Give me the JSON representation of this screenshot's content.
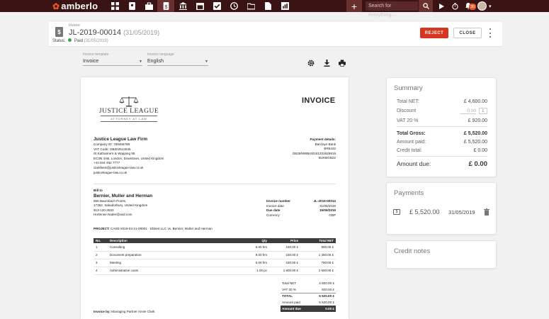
{
  "app": {
    "brand": "amberlo"
  },
  "topbar": {
    "search_placeholder": "Search for everything...",
    "notification_count": "30",
    "nav": [
      {
        "icon": "dashboard-icon"
      },
      {
        "icon": "contacts-icon"
      },
      {
        "icon": "matters-icon"
      },
      {
        "icon": "invoices-icon"
      },
      {
        "icon": "bank-icon"
      },
      {
        "icon": "calendar-icon"
      },
      {
        "icon": "tasks-icon"
      },
      {
        "icon": "time-icon"
      },
      {
        "icon": "folder-icon"
      },
      {
        "icon": "documents-icon"
      },
      {
        "icon": "reports-icon"
      }
    ]
  },
  "header": {
    "doc_type": "Invoice",
    "doc_number": "JL-2019-00014",
    "doc_date": "(31/05/2019)",
    "status_label": "Status:",
    "status_value": "Paid",
    "status_date": "(31/05/2019)",
    "reject_label": "REJECT",
    "close_label": "CLOSE"
  },
  "options": {
    "template_label": "Invoice template",
    "template_value": "Invoice",
    "language_label": "Invoice language",
    "language_value": "English"
  },
  "invoice": {
    "heading": "INVOICE",
    "logo_name": "JUSTICE LEAGUE",
    "logo_sub": "ATTORNEY AT LAW",
    "firm": {
      "name": "Justice League Law Firm",
      "company_id": "Company ID: 789456789",
      "vat_code": "VAT Code: GB002514545",
      "address1": "St Katharine's & Wapping 95",
      "address2": "EC3N 4AB, London, Downtown, United Kingdom",
      "phone": "+44 844 482 7777",
      "email": "clarkkent@justiceleague-law.co.uk",
      "web": "justiceleague-law.co.uk"
    },
    "payment": {
      "title": "Payment details:",
      "bank": "Barclays Bank",
      "code": "BR5442",
      "iban": "GB29NWBK60161331926819",
      "swift": "BUKBGB22"
    },
    "bill_to": {
      "label": "Bill to",
      "name": "Bernier, Muller and Herman",
      "address1": "656 Baumbach Points,",
      "address2": "17352, Sakadorbury, United Kingdom",
      "phone": "913-120-3533",
      "email": "Hortense.Nader@asd.com"
    },
    "meta": [
      {
        "label": "Invoice number",
        "value": "JL-2019-00014"
      },
      {
        "label": "Invoice date",
        "value": "31/05/2019"
      },
      {
        "label": "Due date",
        "value": "15/06/2019"
      },
      {
        "label": "Currency",
        "value": "GBP"
      }
    ],
    "project_label": "PROJECT:",
    "project_value": "CASE-2019-03-21-00001 · Ebbert LLC vs. Bernier, Muller and Herman",
    "columns": [
      "No.",
      "Description",
      "Qty",
      "Price",
      "Total NET"
    ],
    "rows": [
      [
        "1",
        "Consulting",
        "6.00 hrs",
        "150.00 £",
        "900.00 £"
      ],
      [
        "2",
        "Document preparation",
        "9.00 hrs",
        "150.00 £",
        "1 350.00 £"
      ],
      [
        "3",
        "Meeting",
        "5.00 hrs",
        "150.00 £",
        "750.00 £"
      ],
      [
        "4",
        "Administrative costs",
        "1.00 pc",
        "1 600.00 £",
        "1 600.00 £"
      ]
    ],
    "totals": [
      {
        "label": "Total NET",
        "value": "4 600.00 £"
      },
      {
        "label": "VAT 20 %",
        "value": "920.00 £"
      },
      {
        "label": "TOTAL",
        "value": "5 520.00 £"
      },
      {
        "label": "Amount paid",
        "value": "5 520.00 £"
      },
      {
        "label": "Amount due",
        "value": "0.00 £"
      }
    ],
    "invoice_by_label": "Invoice by:",
    "invoice_by_value": "Managing Partner Annie Clark"
  },
  "summary": {
    "title": "Summary",
    "total_net_label": "Total NET:",
    "total_net_value": "£ 4,600.00",
    "discount_label": "Discount",
    "discount_value": "0.00",
    "discount_ccy": "£",
    "vat_label": "VAT 20 %",
    "vat_value": "£ 920.00",
    "total_gross_label": "Total Gross:",
    "total_gross_value": "£ 5,520.00",
    "amount_paid_label": "Amount paid:",
    "amount_paid_value": "£ 5,520.00",
    "credit_total_label": "Credit total:",
    "credit_total_value": "£ 0.00",
    "amount_due_label": "Amount due:",
    "amount_due_value": "£ 0.00"
  },
  "payments": {
    "title": "Payments",
    "amount": "£ 5,520.00",
    "date": "31/05/2019"
  },
  "credit_notes": {
    "title": "Credit notes"
  }
}
